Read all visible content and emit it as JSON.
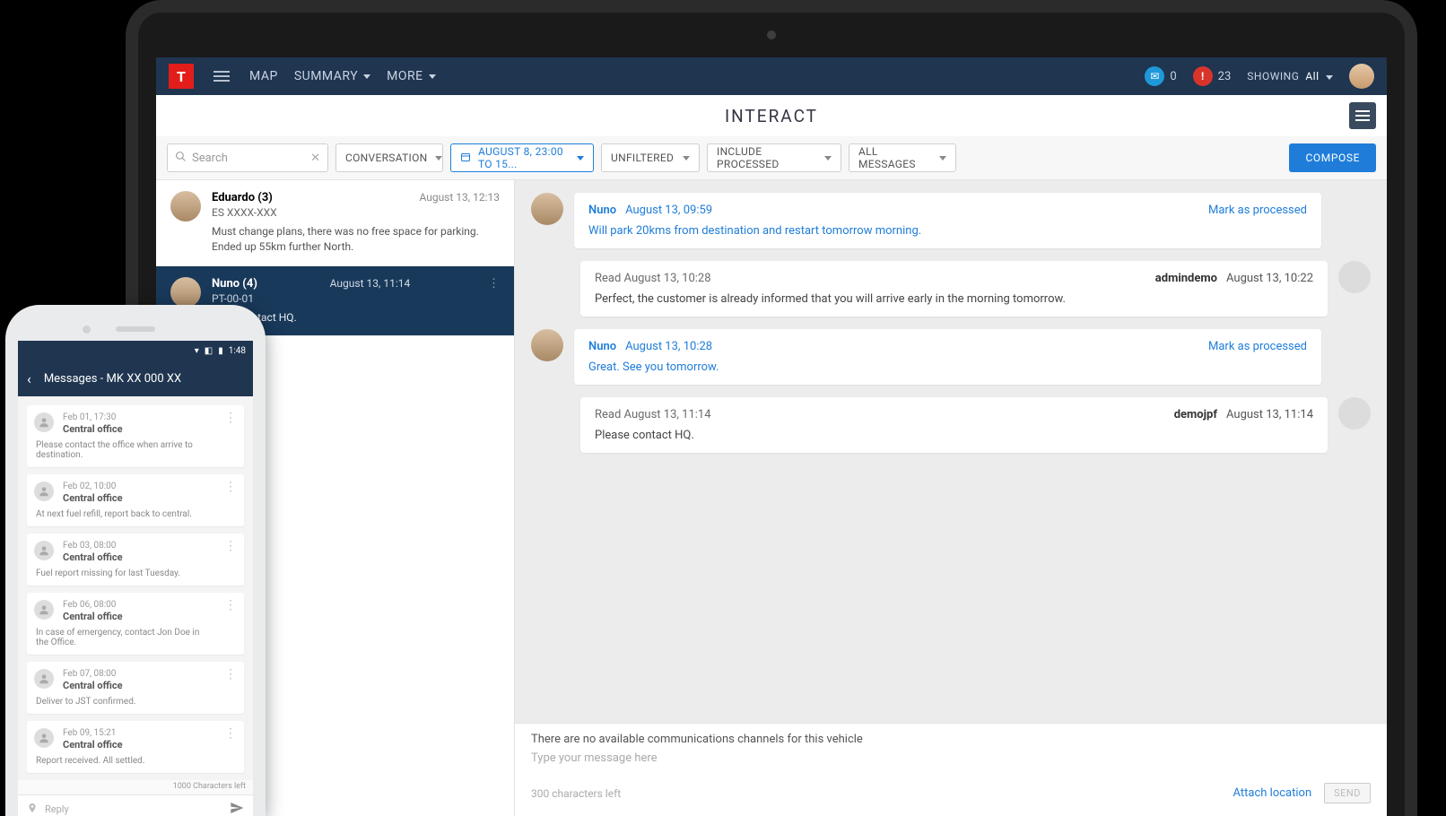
{
  "nav": {
    "brand_glyph": "T",
    "map": "MAP",
    "summary": "SUMMARY",
    "more": "MORE",
    "mail_count": "0",
    "alert_glyph": "!",
    "alert_count": "23",
    "showing_label": "SHOWING",
    "showing_value": "All"
  },
  "page_title": "INTERACT",
  "filters": {
    "search_placeholder": "Search",
    "conversation": "CONVERSATION",
    "date": "AUGUST 8, 23:00 TO 15...",
    "unfiltered": "UNFILTERED",
    "include_processed": "INCLUDE PROCESSED",
    "all_messages": "ALL MESSAGES",
    "compose": "COMPOSE"
  },
  "conversations": [
    {
      "name": "Eduardo (3)",
      "sub": "ES XXXX-XXX",
      "time": "August 13, 12:13",
      "preview": "Must change plans, there was no free space for parking. Ended up 55km further North."
    },
    {
      "name": "Nuno (4)",
      "sub": "PT-00-01",
      "time": "August 13, 11:14",
      "preview": "lease contact HQ."
    }
  ],
  "thread": [
    {
      "dir": "in",
      "who": "Nuno",
      "ts": "August 13, 09:59",
      "action": "Mark as processed",
      "text": "Will park 20kms from destination and restart tomorrow morning."
    },
    {
      "dir": "out",
      "read": "Read August 13, 10:28",
      "who": "admindemo",
      "ts": "August 13, 10:22",
      "text": "Perfect, the customer is already informed that you will arrive early in the morning tomorrow."
    },
    {
      "dir": "in",
      "who": "Nuno",
      "ts": "August 13, 10:28",
      "action": "Mark as processed",
      "text": "Great. See you tomorrow."
    },
    {
      "dir": "out",
      "read": "Read August 13, 11:14",
      "who": "demojpf",
      "ts": "August 13, 11:14",
      "text": "Please contact HQ."
    }
  ],
  "composer": {
    "warn": "There are no available communications channels for this vehicle",
    "placeholder": "Type your message here",
    "chars_left": "300 characters left",
    "attach": "Attach location",
    "send": "SEND"
  },
  "phone": {
    "clock": "1:48",
    "header": "Messages - MK XX 000 XX",
    "chars_left": "1000 Characters left",
    "reply_placeholder": "Reply",
    "msgs": [
      {
        "t": "Feb 01, 17:30",
        "from": "Central office",
        "body": "Please contact the office when arrive to destination."
      },
      {
        "t": "Feb 02, 10:00",
        "from": "Central office",
        "body": "At next fuel refill, report back to central."
      },
      {
        "t": "Feb 03, 08:00",
        "from": "Central office",
        "body": "Fuel report missing for last Tuesday."
      },
      {
        "t": "Feb 06, 08:00",
        "from": "Central office",
        "body": "In case of emergency, contact Jon Doe in the Office."
      },
      {
        "t": "Feb 07, 08:00",
        "from": "Central office",
        "body": "Deliver to JST confirmed."
      },
      {
        "t": "Feb 09, 15:21",
        "from": "Central office",
        "body": "Report received. All settled."
      }
    ]
  }
}
